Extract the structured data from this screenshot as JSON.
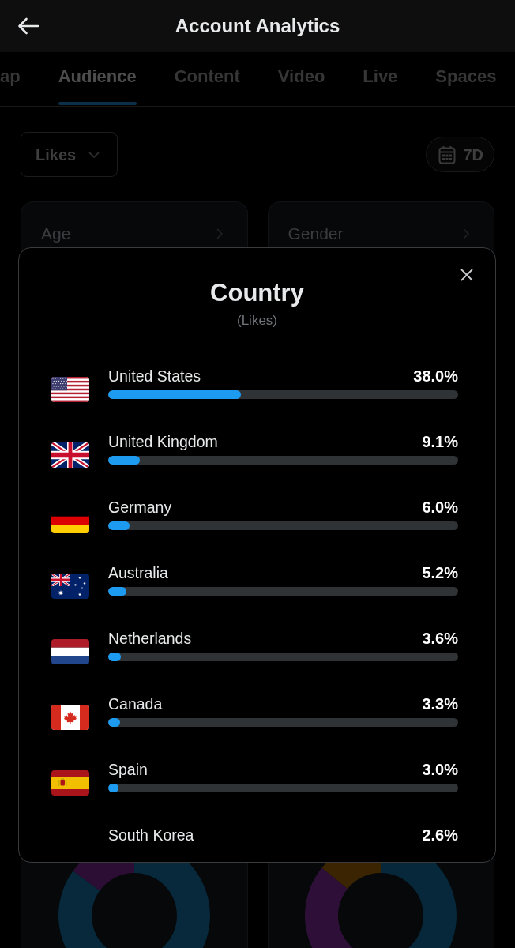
{
  "header": {
    "title": "Account Analytics"
  },
  "tabs": [
    {
      "label": "ap",
      "selected": false
    },
    {
      "label": "Audience",
      "selected": true
    },
    {
      "label": "Content",
      "selected": false
    },
    {
      "label": "Video",
      "selected": false
    },
    {
      "label": "Live",
      "selected": false
    },
    {
      "label": "Spaces",
      "selected": false
    }
  ],
  "filters": {
    "metric": "Likes",
    "range": "7D"
  },
  "cards": [
    {
      "title": "Age"
    },
    {
      "title": "Gender"
    }
  ],
  "modal": {
    "title": "Country",
    "subtitle": "(Likes)",
    "rows": [
      {
        "kind": "us",
        "country": "United States",
        "value": "38.0%",
        "level": 0.38
      },
      {
        "kind": "gb",
        "country": "United Kingdom",
        "value": "9.1%",
        "level": 0.091
      },
      {
        "kind": "de",
        "country": "Germany",
        "value": "6.0%",
        "level": 0.06
      },
      {
        "kind": "au",
        "country": "Australia",
        "value": "5.2%",
        "level": 0.052
      },
      {
        "kind": "nl",
        "country": "Netherlands",
        "value": "3.6%",
        "level": 0.036
      },
      {
        "kind": "ca",
        "country": "Canada",
        "value": "3.3%",
        "level": 0.033
      },
      {
        "kind": "es",
        "country": "Spain",
        "value": "3.0%",
        "level": 0.03
      },
      {
        "country": "South Korea",
        "value": "2.6%"
      }
    ]
  }
}
